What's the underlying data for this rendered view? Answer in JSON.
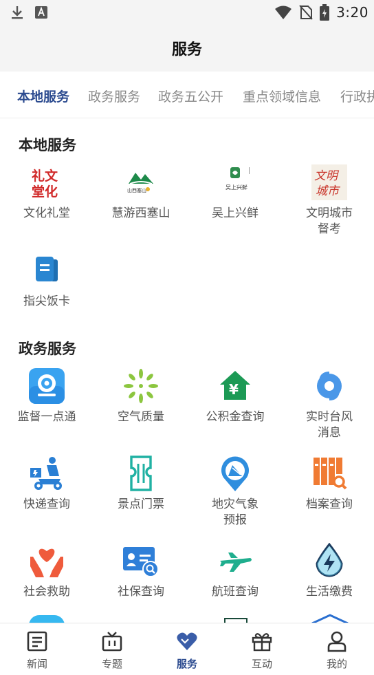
{
  "status_bar": {
    "time": "3:20"
  },
  "header": {
    "title": "服务"
  },
  "tabs": [
    {
      "label": "本地服务",
      "active": true
    },
    {
      "label": "政务服务",
      "active": false
    },
    {
      "label": "政务五公开",
      "active": false
    },
    {
      "label": "重点领域信息",
      "active": false
    },
    {
      "label": "行政执法",
      "active": false
    }
  ],
  "local_services": {
    "title": "本地服务",
    "items": [
      {
        "label": "文化礼堂",
        "icon": "culture-hall-logo"
      },
      {
        "label": "慧游西塞山",
        "icon": "xisaishan-logo"
      },
      {
        "label": "吴上兴鲜",
        "icon": "wushang-logo"
      },
      {
        "label": "文明城市\n督考",
        "icon": "civilized-city-logo"
      },
      {
        "label": "指尖饭卡",
        "icon": "meal-card-icon"
      }
    ]
  },
  "gov_services": {
    "title": "政务服务",
    "items": [
      {
        "label": "监督一点通",
        "icon": "camera-icon"
      },
      {
        "label": "空气质量",
        "icon": "air-quality-icon"
      },
      {
        "label": "公积金查询",
        "icon": "housing-fund-icon"
      },
      {
        "label": "实时台风\n消息",
        "icon": "typhoon-icon"
      },
      {
        "label": "快递查询",
        "icon": "courier-icon"
      },
      {
        "label": "景点门票",
        "icon": "ticket-icon"
      },
      {
        "label": "地灾气象\n预报",
        "icon": "landslide-icon"
      },
      {
        "label": "档案查询",
        "icon": "archive-icon"
      },
      {
        "label": "社会救助",
        "icon": "relief-icon"
      },
      {
        "label": "社保查询",
        "icon": "social-security-icon"
      },
      {
        "label": "航班查询",
        "icon": "flight-icon"
      },
      {
        "label": "生活缴费",
        "icon": "utility-payment-icon"
      }
    ]
  },
  "bottom_nav": [
    {
      "label": "新闻",
      "icon": "news-icon",
      "active": false
    },
    {
      "label": "专题",
      "icon": "tv-icon",
      "active": false
    },
    {
      "label": "服务",
      "icon": "service-heart-icon",
      "active": true
    },
    {
      "label": "互动",
      "icon": "gift-icon",
      "active": false
    },
    {
      "label": "我的",
      "icon": "user-icon",
      "active": false
    }
  ],
  "colors": {
    "accent": "#2b4a8f",
    "active_nav": "#3a5da8"
  }
}
